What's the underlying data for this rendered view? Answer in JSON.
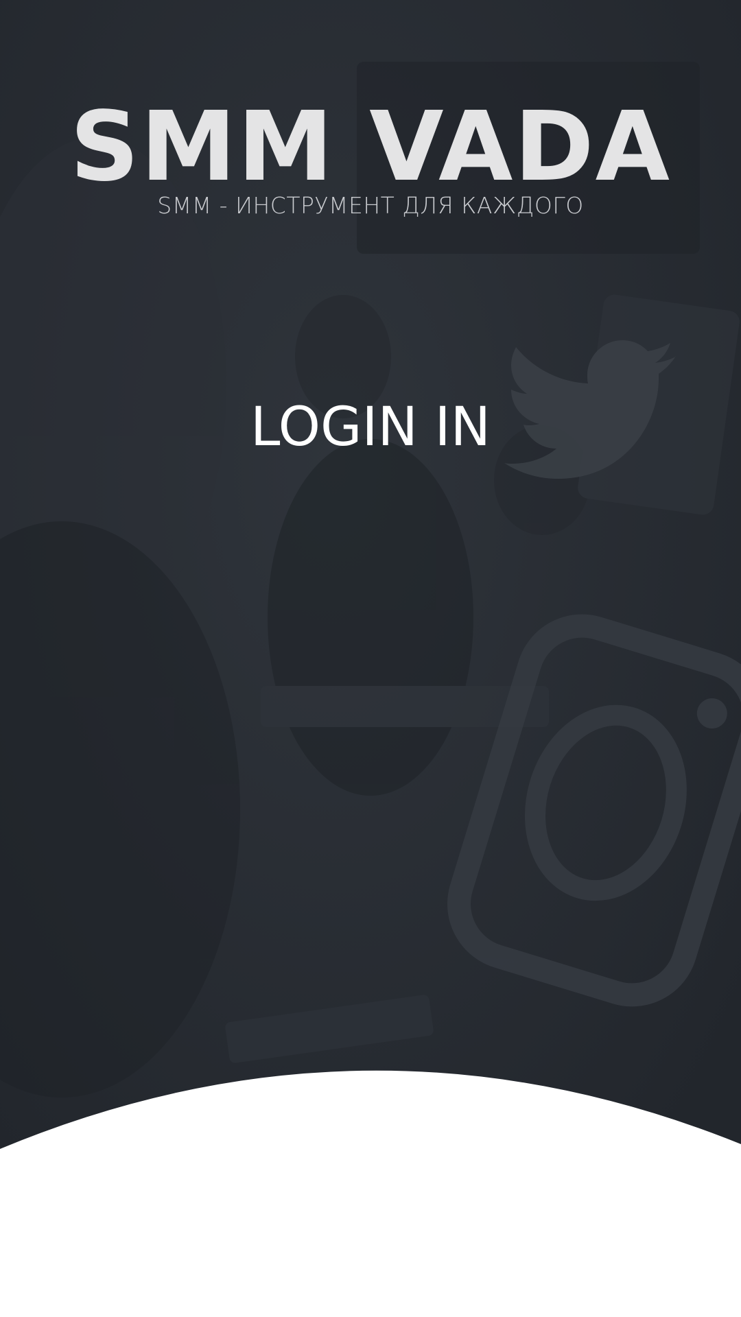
{
  "brand": {
    "title": "SMM VADA",
    "subtitle": "SMM - ИНСТРУМЕНТ ДЛЯ КАЖДОГО"
  },
  "login": {
    "heading": "LOGIN IN"
  },
  "background": {
    "overlay_color": "#262a30",
    "panel_color": "#ffffff",
    "icons": [
      "twitter-icon",
      "instagram-icon"
    ]
  }
}
